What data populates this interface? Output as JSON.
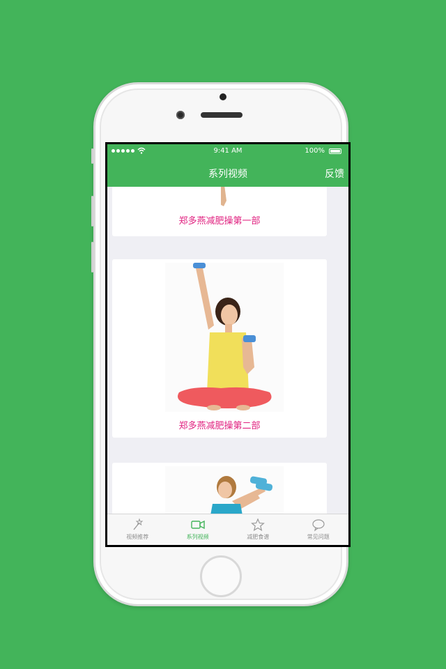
{
  "status_bar": {
    "time": "9:41 AM",
    "battery": "100%"
  },
  "nav": {
    "title": "系列视频",
    "right_button": "反馈"
  },
  "cards": [
    {
      "title": "郑多燕减肥操第一部"
    },
    {
      "title": "郑多燕减肥操第二部"
    },
    {
      "title": ""
    }
  ],
  "tabs": [
    {
      "label": "视频推荐",
      "icon": "magic-wand-icon",
      "active": false
    },
    {
      "label": "系列视频",
      "icon": "video-camera-icon",
      "active": true
    },
    {
      "label": "减肥食谱",
      "icon": "star-icon",
      "active": false
    },
    {
      "label": "常见问题",
      "icon": "chat-bubble-icon",
      "active": false
    }
  ],
  "colors": {
    "brand": "#43b45a",
    "title_pink": "#e0207f",
    "background": "#efeff4"
  }
}
